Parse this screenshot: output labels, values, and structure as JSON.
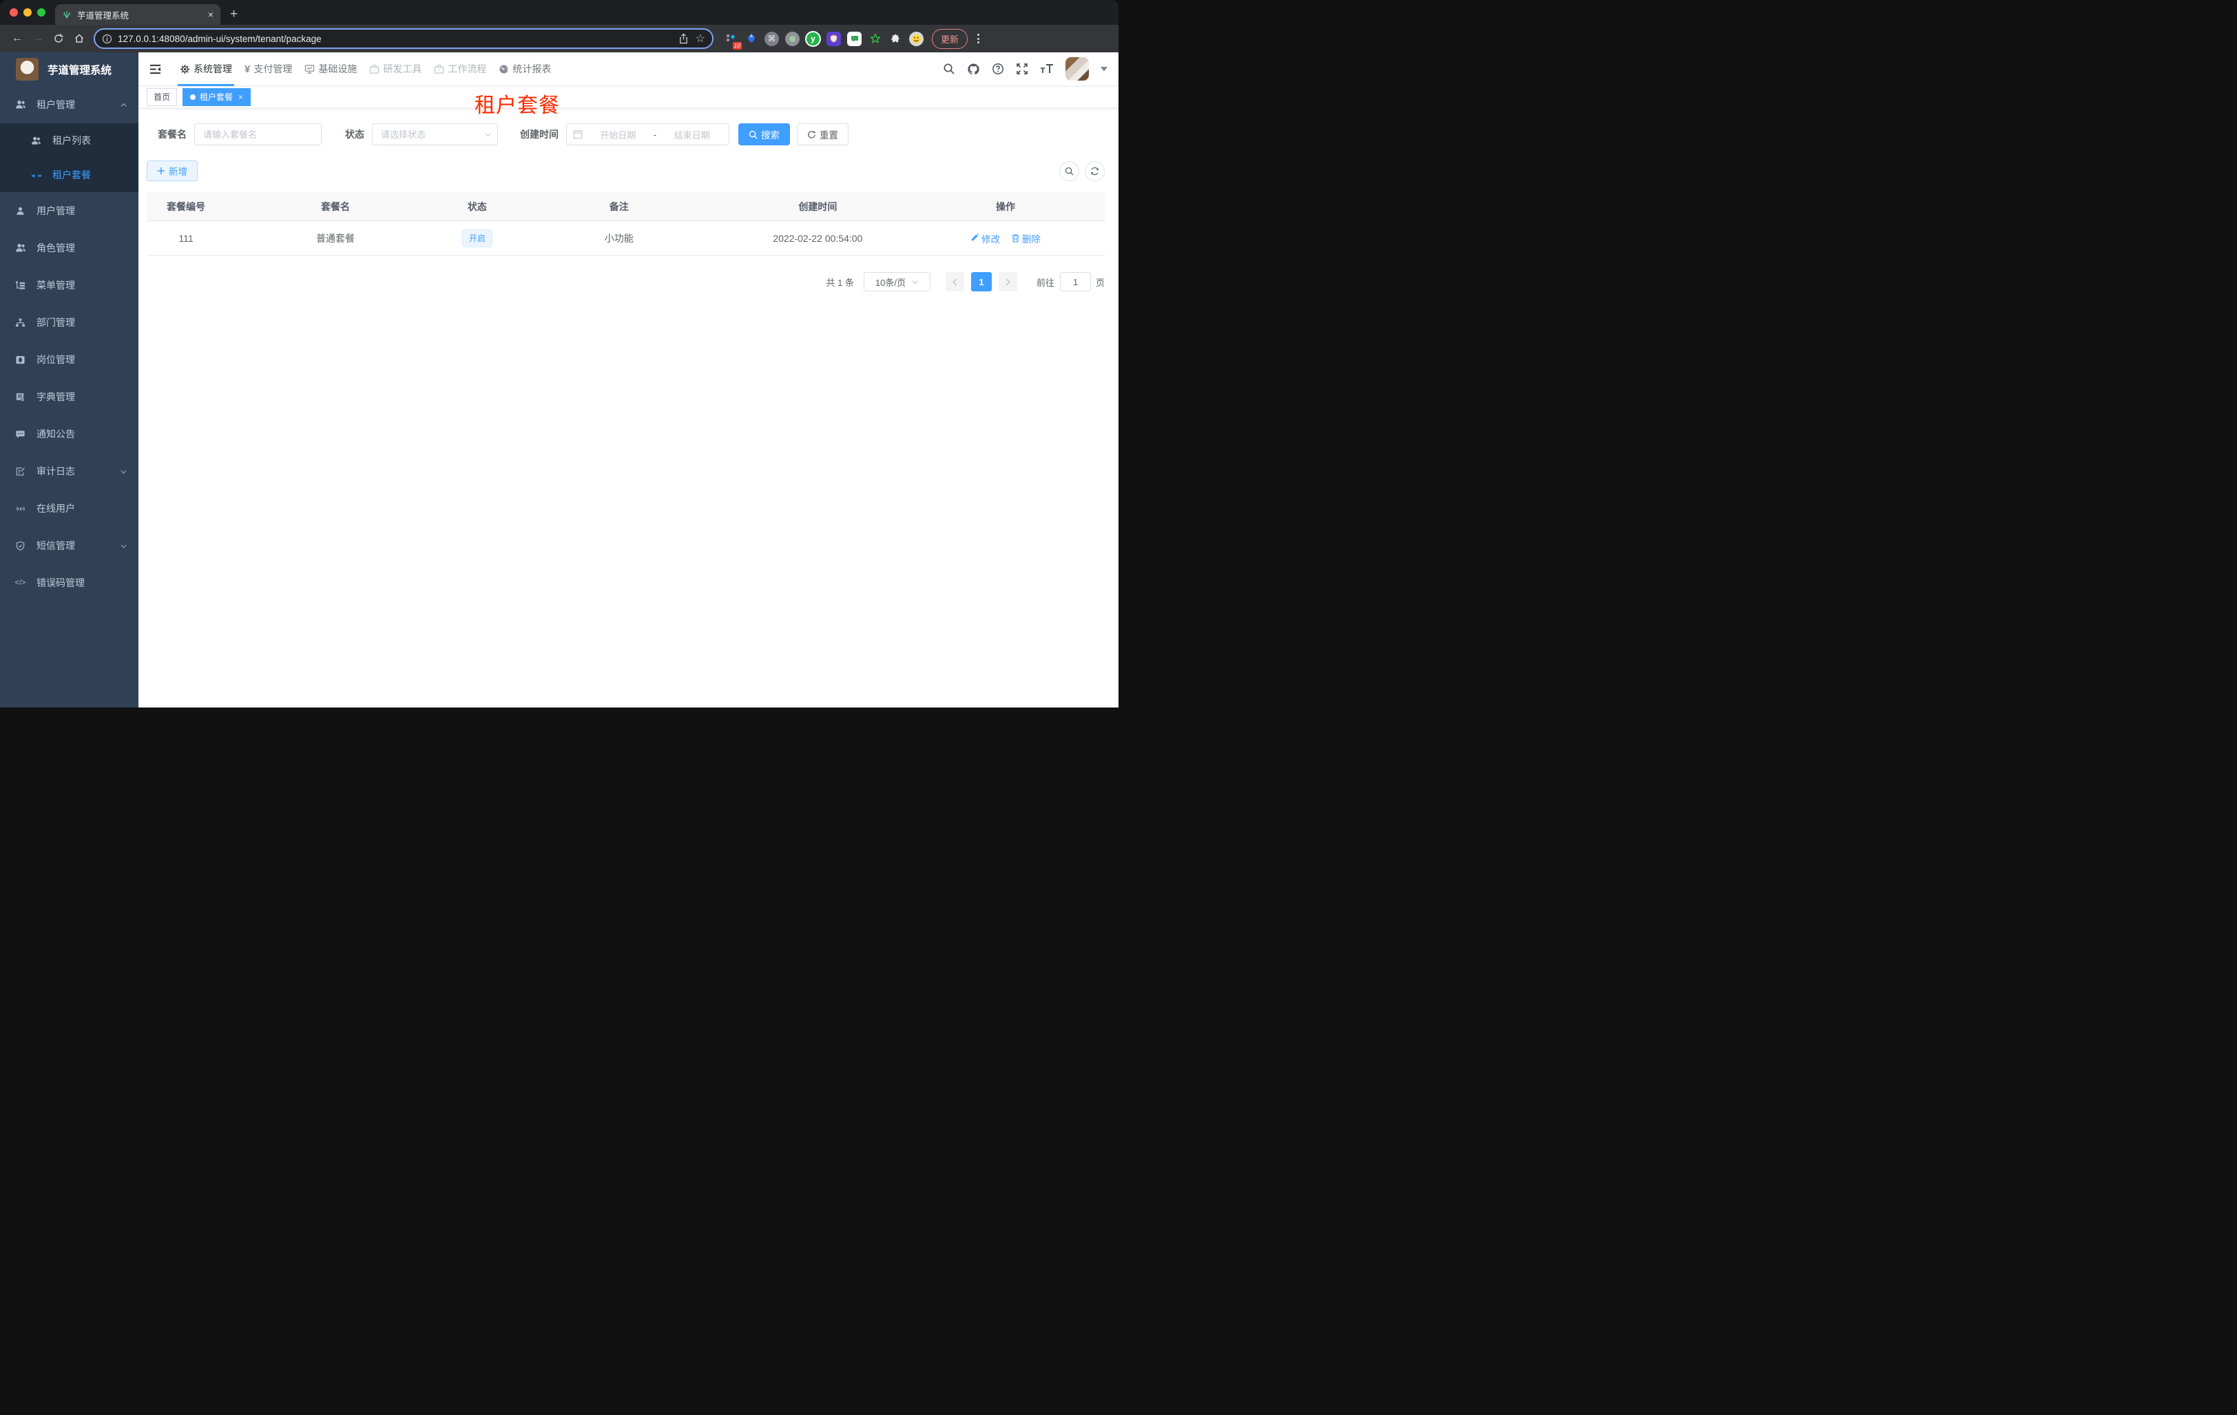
{
  "browser": {
    "tab_title": "芋道管理系统",
    "url": "127.0.0.1:48080/admin-ui/system/tenant/package",
    "update_label": "更新",
    "extension_badge": "10"
  },
  "icons": {
    "yen": "¥",
    "code": "</>",
    "close": "×",
    "star": "☆",
    "back": "←",
    "forward": "→",
    "plus": "+",
    "command": "⌘",
    "y_letter": "y"
  },
  "sidebar": {
    "title": "芋道管理系统",
    "items": [
      {
        "label": "租户管理"
      },
      {
        "label": "租户列表"
      },
      {
        "label": "租户套餐"
      },
      {
        "label": "用户管理"
      },
      {
        "label": "角色管理"
      },
      {
        "label": "菜单管理"
      },
      {
        "label": "部门管理"
      },
      {
        "label": "岗位管理"
      },
      {
        "label": "字典管理"
      },
      {
        "label": "通知公告"
      },
      {
        "label": "审计日志"
      },
      {
        "label": "在线用户"
      },
      {
        "label": "短信管理"
      },
      {
        "label": "错误码管理"
      }
    ]
  },
  "topnav": {
    "items": [
      {
        "label": "系统管理"
      },
      {
        "label": "支付管理"
      },
      {
        "label": "基础设施"
      },
      {
        "label": "研发工具"
      },
      {
        "label": "工作流程"
      },
      {
        "label": "统计报表"
      }
    ]
  },
  "tags": {
    "home": "首页",
    "active": "租户套餐"
  },
  "annotation": "租户套餐",
  "filters": {
    "name_label": "套餐名",
    "name_placeholder": "请输入套餐名",
    "status_label": "状态",
    "status_placeholder": "请选择状态",
    "date_label": "创建时间",
    "date_start": "开始日期",
    "date_sep": "-",
    "date_end": "结束日期",
    "search_label": "搜索",
    "reset_label": "重置"
  },
  "toolbar": {
    "add_label": "新增"
  },
  "table": {
    "headers": [
      "套餐编号",
      "套餐名",
      "状态",
      "备注",
      "创建时间",
      "操作"
    ],
    "rows": [
      {
        "id": "111",
        "name": "普通套餐",
        "status": "开启",
        "remark": "小功能",
        "created": "2022-02-22 00:54:00",
        "edit": "修改",
        "delete": "删除"
      }
    ]
  },
  "pagination": {
    "total": "共 1 条",
    "size": "10条/页",
    "page": "1",
    "goto": "前往",
    "unit": "页",
    "goto_value": "1"
  }
}
